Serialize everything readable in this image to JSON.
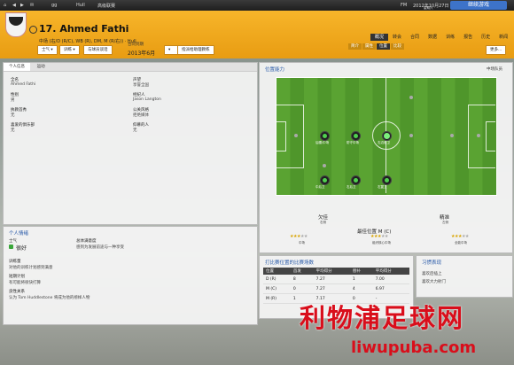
{
  "topbar": {
    "left1": "gg",
    "club": "Hull",
    "menu": "高级联赛",
    "mode": "FM",
    "date": "2012年10月27日",
    "day": "星期六",
    "continue_label": "继续游戏"
  },
  "header": {
    "player_name": "17. Ahmed Fathi",
    "positions": "中场 (右/D (R/C), WB (R), DM, M (R/右)) · Hull",
    "tabs": [
      "概况",
      "转会",
      "合同",
      "数据",
      "训练",
      "报告",
      "历史",
      "新闻"
    ],
    "active_tab": "概况",
    "subtabs": [
      "简介",
      "属性",
      "位置",
      "比较"
    ],
    "active_subtab": "位置",
    "buttons": {
      "morale": "士气",
      "training": "训练",
      "interact": "与球员谈话",
      "contract_label": "合同到期",
      "contract_value": "2013年6月",
      "assign": "指派给助理教练",
      "more": "更多..."
    }
  },
  "info_panel": {
    "tabs": [
      "个人信息",
      "运动"
    ],
    "active_tab": "个人信息",
    "rows_left": [
      {
        "label": "全名",
        "value": "Ahmed Fathi"
      },
      {
        "label": "性别",
        "value": "男"
      },
      {
        "label": "执教首秀",
        "value": "无"
      },
      {
        "label": "喜爱的俱乐部",
        "value": "无"
      }
    ],
    "rows_right": [
      {
        "label": "声望",
        "value": "享誉全国"
      },
      {
        "label": "经纪人",
        "value": "Jason Langton"
      },
      {
        "label": "公关风格",
        "value": "拒绝媒体"
      },
      {
        "label": "仰慕的人",
        "value": "无"
      }
    ]
  },
  "positions_panel": {
    "title": "位置能力",
    "right_label": "中场队员",
    "position_dots": [
      {
        "label": "后腰/中场",
        "best": false
      },
      {
        "label": "防守中场",
        "best": false
      },
      {
        "label": "右边前卫",
        "best": true
      },
      {
        "label": "中后卫",
        "best": false
      },
      {
        "label": "右后卫",
        "best": false
      },
      {
        "label": "右翼卫",
        "best": false
      }
    ],
    "summary": {
      "left_title": "欠佳",
      "left_sub": "右侧",
      "mid_title": "精准",
      "mid_sub": "左侧",
      "best_label": "最佳位置 M (C)",
      "role1": "中场",
      "role1_stars": 3,
      "role2": "组织核心中场",
      "role2_stars": 3,
      "role3": "全能中场",
      "role3_stars": 3
    }
  },
  "personal_panel": {
    "title": "个人情绪",
    "morale_label": "士气",
    "morale_value": "很好",
    "morale_note_label": "总体满意度",
    "morale_note": "感到为发展前途与一种享受",
    "training_label": "训练量",
    "training_value": "对他的训练计划感到满意",
    "plan_label": "短期计划",
    "plan_value": "有可能将很快打算",
    "rel_label": "良性关系",
    "rel_value": "认为 Tom Huddlestone 将成为他的榜样人物"
  },
  "stats_panel": {
    "title": "打比赛位置的比赛场数",
    "columns": [
      "位置",
      "首发",
      "平均得分",
      "替补",
      "平均得分"
    ],
    "rows": [
      [
        "D (R)",
        "8",
        "7.27",
        "1",
        "7.00"
      ],
      [
        "M (C)",
        "0",
        "7.27",
        "4",
        "6.97"
      ],
      [
        "M (R)",
        "1",
        "7.17",
        "0",
        "-"
      ]
    ]
  },
  "habits_panel": {
    "title": "习惯表现",
    "items": [
      "喜欢后插上",
      "喜欢大力射门"
    ]
  },
  "watermark": {
    "cn": "利物浦足球网",
    "en": "liwupuba.com"
  }
}
